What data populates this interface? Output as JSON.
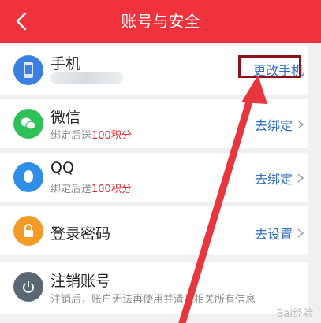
{
  "header": {
    "title": "账号与安全"
  },
  "rows": [
    {
      "name": "手机",
      "sub_prefix": "",
      "sub_points": "",
      "action": "更改手机"
    },
    {
      "name": "微信",
      "sub_prefix": "绑定后送",
      "sub_points": "100积分",
      "action": "去绑定"
    },
    {
      "name": "QQ",
      "sub_prefix": "绑定后送",
      "sub_points": "100积分",
      "action": "去绑定"
    },
    {
      "name": "登录密码",
      "sub_prefix": "",
      "sub_points": "",
      "action": "去设置"
    },
    {
      "name": "注销账号",
      "sub_prefix": "注销后，账户无法再使用并清除相关所有信息",
      "sub_points": "",
      "action": ""
    }
  ],
  "watermark": "Bai经验",
  "colors": {
    "header": "#f0323c",
    "accent": "#e5202a",
    "link": "#2f6fc4",
    "phone_icon": "#3b80df",
    "wechat_icon": "#2ec15a",
    "qq_icon": "#2f8fe7",
    "password_icon": "#f39a27",
    "deactivate_icon": "#5b6773"
  }
}
